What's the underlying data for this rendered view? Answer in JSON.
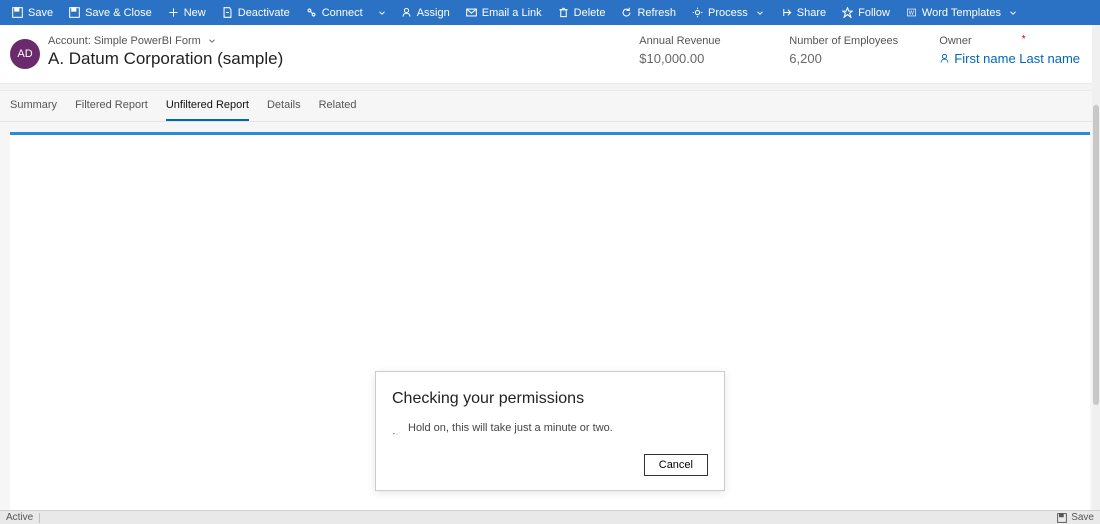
{
  "ribbon": {
    "save": "Save",
    "save_close": "Save & Close",
    "new": "New",
    "deactivate": "Deactivate",
    "connect": "Connect",
    "assign": "Assign",
    "email_link": "Email a Link",
    "delete": "Delete",
    "refresh": "Refresh",
    "process": "Process",
    "share": "Share",
    "follow": "Follow",
    "word_templates": "Word Templates"
  },
  "header": {
    "avatar_initials": "AD",
    "account_type_line": "Account: Simple PowerBI Form",
    "account_name": "A. Datum Corporation (sample)",
    "annual_revenue_label": "Annual Revenue",
    "annual_revenue_value": "$10,000.00",
    "num_employees_label": "Number of Employees",
    "num_employees_value": "6,200",
    "owner_label": "Owner",
    "owner_value": "First name Last name"
  },
  "tabs": {
    "summary": "Summary",
    "filtered": "Filtered Report",
    "unfiltered": "Unfiltered Report",
    "details": "Details",
    "related": "Related"
  },
  "dialog": {
    "title": "Checking your permissions",
    "message": "Hold on, this will take just a minute or two.",
    "cancel": "Cancel"
  },
  "footer": {
    "status": "Active",
    "save": "Save"
  }
}
